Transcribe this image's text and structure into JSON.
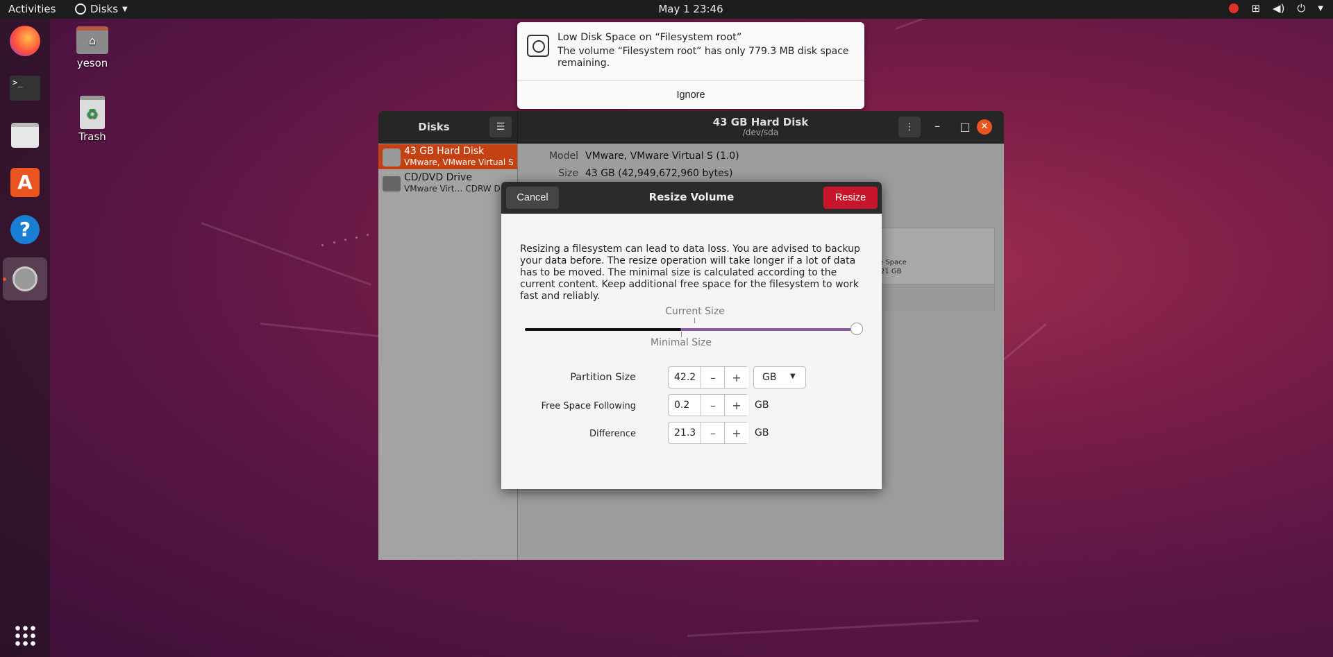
{
  "topbar": {
    "activities": "Activities",
    "app_name": "Disks",
    "clock": "May 1  23:46"
  },
  "desktop": {
    "home_label": "yeson",
    "trash_label": "Trash"
  },
  "notification": {
    "title": "Low Disk Space on “Filesystem root”",
    "body": "The volume “Filesystem root” has only 779.3 MB disk space remaining.",
    "ignore": "Ignore"
  },
  "disks_window": {
    "sidebar_title": "Disks",
    "title": "43 GB Hard Disk",
    "subtitle": "/dev/sda",
    "drives": [
      {
        "name": "43 GB Hard Disk",
        "desc": "VMware, VMware Virtual S"
      },
      {
        "name": "CD/DVD Drive",
        "desc": "VMware Virt… CDRW Drive"
      }
    ],
    "info": {
      "model_label": "Model",
      "model_value": "VMware, VMware Virtual S (1.0)",
      "size_label": "Size",
      "size_value": "43 GB (42,949,672,960 bytes)"
    },
    "partial_volume": {
      "line1": "e Space",
      "line2": "21 GB"
    }
  },
  "resize_dialog": {
    "title": "Resize Volume",
    "cancel": "Cancel",
    "resize": "Resize",
    "warning": "Resizing a filesystem can lead to data loss. You are advised to backup your data before. The resize operation will take longer if a lot of data has to be moved. The minimal size is calculated according to the current content. Keep additional free space for the filesystem to work fast and reliably.",
    "current_size_label": "Current Size",
    "minimal_size_label": "Minimal Size",
    "slider": {
      "minimal_fraction": 0.47,
      "current_fraction": 0.51,
      "value_fraction": 1.0
    },
    "partition_size_label": "Partition Size",
    "partition_size_value": "42.2",
    "unit_selected": "GB",
    "free_space_label": "Free Space Following",
    "free_space_value": "0.2",
    "free_space_unit": "GB",
    "difference_label": "Difference",
    "difference_value": "21.3",
    "difference_unit": "GB"
  }
}
